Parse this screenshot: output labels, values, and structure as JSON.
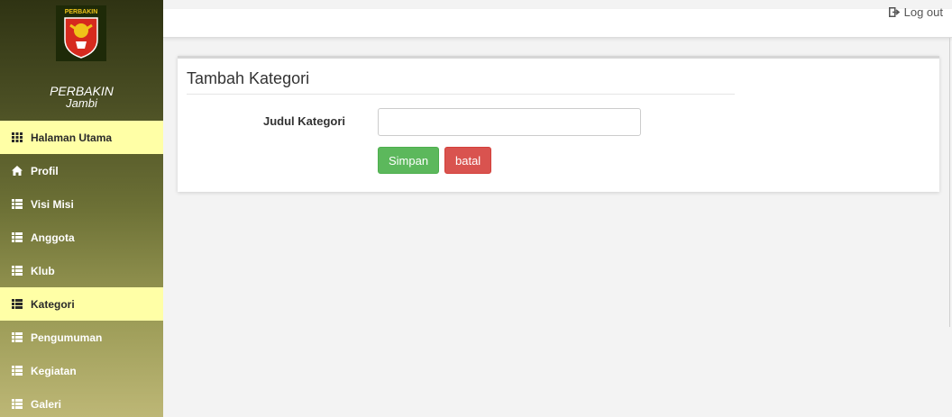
{
  "brand": {
    "logo_text": "PERBAKIN",
    "name": "PERBAKIN",
    "region": "Jambi"
  },
  "sidebar": {
    "items": [
      {
        "label": "Halaman Utama",
        "icon": "grid-icon",
        "active": true
      },
      {
        "label": "Profil",
        "icon": "home-icon",
        "active": false
      },
      {
        "label": "Visi Misi",
        "icon": "list-icon",
        "active": false
      },
      {
        "label": "Anggota",
        "icon": "list-icon",
        "active": false
      },
      {
        "label": "Klub",
        "icon": "list-icon",
        "active": false
      },
      {
        "label": "Kategori",
        "icon": "list-icon",
        "active": true
      },
      {
        "label": "Pengumuman",
        "icon": "list-icon",
        "active": false
      },
      {
        "label": "Kegiatan",
        "icon": "list-icon",
        "active": false
      },
      {
        "label": "Galeri",
        "icon": "list-icon",
        "active": false
      }
    ]
  },
  "topbar": {
    "logout_label": "Log out",
    "logout_icon": "logout-icon"
  },
  "form": {
    "title": "Tambah Kategori",
    "field_label": "Judul Kategori",
    "field_value": "",
    "field_placeholder": "",
    "save_label": "Simpan",
    "cancel_label": "batal"
  },
  "colors": {
    "active_item": "#ffffa6",
    "save_button": "#5cb85c",
    "cancel_button": "#d9534f"
  }
}
